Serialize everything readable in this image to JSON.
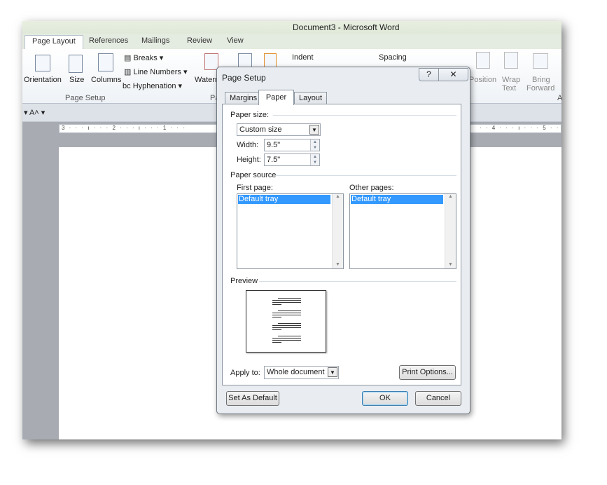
{
  "window": {
    "title": "Document3  -  Microsoft Word"
  },
  "ribbon": {
    "tabs": [
      {
        "label": "Page Layout",
        "active": true
      },
      {
        "label": "References"
      },
      {
        "label": "Mailings"
      },
      {
        "label": "Review"
      },
      {
        "label": "View"
      }
    ],
    "page_setup": {
      "orientation": "Orientation",
      "size": "Size",
      "columns": "Columns",
      "breaks": "Breaks",
      "line_numbers": "Line Numbers",
      "hyphenation": "Hyphenation",
      "group_label": "Page Setup"
    },
    "watermark": "Waterm",
    "paragraph_group_partial": "Pa",
    "indent": "Indent",
    "spacing": "Spacing",
    "arrange": {
      "position": "Position",
      "wrap_text_1": "Wrap",
      "wrap_text_2": "Text",
      "bring_forward_1": "Bring",
      "bring_forward_2": "Forward",
      "group_partial": "A"
    }
  },
  "ruler": {
    "text": "3 · · · ı · · · 2 · · · ı · · · 1 · · ·",
    "right_text": "· · 4 · · · ı · · · 5 · ·"
  },
  "dialog": {
    "title": "Page Setup",
    "help": "?",
    "close": "✕",
    "tabs": [
      {
        "label": "Margins"
      },
      {
        "label": "Paper",
        "active": true
      },
      {
        "label": "Layout"
      }
    ],
    "paper_size_label": "Paper size:",
    "paper_size_value": "Custom size",
    "width_label": "Width:",
    "width_value": "9.5\"",
    "height_label": "Height:",
    "height_value": "7.5\"",
    "paper_source_label": "Paper source",
    "first_page_label": "First page:",
    "first_page_selected": "Default tray",
    "other_pages_label": "Other pages:",
    "other_pages_selected": "Default tray",
    "preview_label": "Preview",
    "apply_to_label": "Apply to:",
    "apply_to_value": "Whole document",
    "print_options": "Print Options...",
    "set_default": "Set As Default",
    "ok": "OK",
    "cancel": "Cancel"
  }
}
